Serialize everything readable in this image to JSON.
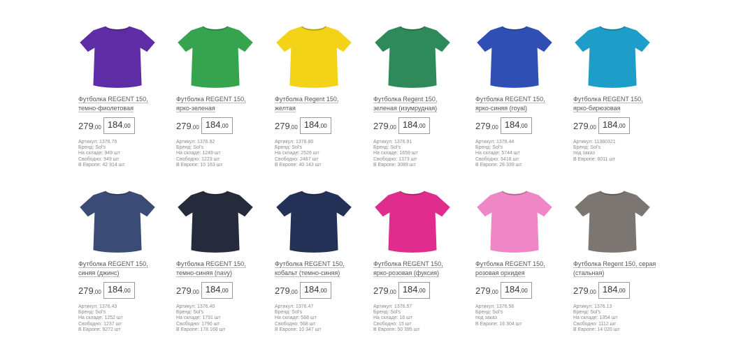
{
  "products": [
    {
      "title": "Футболка REGENT 150, темно-фиолетовая",
      "color": "#5e2ca5",
      "old_int": "279",
      "old_dec": ",00",
      "new_int": "184",
      "new_dec": ",00",
      "meta": [
        "Артикул: 1376.76",
        "Бренд: Sol's",
        "На складе: 949 шт",
        "Свободно: 949 шт",
        "В Европе: 42 914 шт"
      ]
    },
    {
      "title": "Футболка REGENT 150, ярко-зеленая",
      "color": "#36a44e",
      "old_int": "279",
      "old_dec": ",00",
      "new_int": "184",
      "new_dec": ",00",
      "meta": [
        "Артикул: 1376.92",
        "Бренд: Sol's",
        "На складе: 1249 шт",
        "Свободно: 1223 шт",
        "В Европе: 10 163 шт"
      ]
    },
    {
      "title": "Футболка Regent 150, желтая",
      "color": "#f2d317",
      "old_int": "279",
      "old_dec": ",00",
      "new_int": "184",
      "new_dec": ",00",
      "meta": [
        "Артикул: 1376.80",
        "Бренд: Sol's",
        "На складе: 2526 шт",
        "Свободно: 2487 шт",
        "В Европе: 40 143 шт"
      ]
    },
    {
      "title": "Футболка Regent 150, зеленая (изумрудная)",
      "color": "#2e8a5a",
      "old_int": "279",
      "old_dec": ",00",
      "new_int": "184",
      "new_dec": ",00",
      "meta": [
        "Артикул: 1376.91",
        "Бренд: Sol's",
        "На складе: 1659 шт",
        "Свободно: 1373 шт",
        "В Европе: 3089 шт"
      ]
    },
    {
      "title": "Футболка REGENT 150, ярко-синяя (royal)",
      "color": "#2f4fb5",
      "old_int": "279",
      "old_dec": ",00",
      "new_int": "184",
      "new_dec": ",00",
      "meta": [
        "Артикул: 1376.44",
        "Бренд: Sol's",
        "На складе: 5744 шт",
        "Свободно: 5418 шт",
        "В Европе: 26 339 шт"
      ]
    },
    {
      "title": "Футболка REGENT 150, ярко-бирюзовая",
      "color": "#1e9dc9",
      "old_int": "279",
      "old_dec": ",00",
      "new_int": "184",
      "new_dec": ",00",
      "meta": [
        "Артикул: 11380321",
        "Бренд: Sol's",
        "под заказ",
        "В Европе: 6011 шт"
      ]
    },
    {
      "title": "Футболка REGENT 150, синяя (джинс)",
      "color": "#3a4c75",
      "old_int": "279",
      "old_dec": ",00",
      "new_int": "184",
      "new_dec": ",00",
      "meta": [
        "Артикул: 1376.43",
        "Бренд: Sol's",
        "На складе: 1252 шт",
        "Свободно: 1237 шт",
        "В Европе: 9272 шт"
      ]
    },
    {
      "title": "Футболка REGENT 150, темно-синяя (navy)",
      "color": "#252b3a",
      "old_int": "279",
      "old_dec": ",00",
      "new_int": "184",
      "new_dec": ",00",
      "meta": [
        "Артикул: 1376.40",
        "Бренд: Sol's",
        "На складе: 1791 шт",
        "Свободно: 1790 шт",
        "В Европе: 178 168 шт"
      ]
    },
    {
      "title": "Футболка REGENT 150, кобальт (темно-синяя)",
      "color": "#243156",
      "old_int": "279",
      "old_dec": ",00",
      "new_int": "184",
      "new_dec": ",00",
      "meta": [
        "Артикул: 1376.47",
        "Бренд: Sol's",
        "На складе: 568 шт",
        "Свободно: 568 шт",
        "В Европе: 10 347 шт"
      ]
    },
    {
      "title": "Футболка REGENT 150, ярко-розовая (фуксия)",
      "color": "#e02c8d",
      "old_int": "279",
      "old_dec": ",00",
      "new_int": "184",
      "new_dec": ",00",
      "meta": [
        "Артикул: 1376.57",
        "Бренд: Sol's",
        "На складе: 16 шт",
        "Свободно: 15 шт",
        "В Европе: 50 395 шт"
      ]
    },
    {
      "title": "Футболка REGENT 150, розовая орхидея",
      "color": "#ef86c6",
      "old_int": "279",
      "old_dec": ",00",
      "new_int": "184",
      "new_dec": ",00",
      "meta": [
        "Артикул: 1376.56",
        "Бренд: Sol's",
        "под заказ",
        "В Европе: 16 304 шт"
      ]
    },
    {
      "title": "Футболка Regent 150, серая (стальная)",
      "color": "#7b7672",
      "old_int": "279",
      "old_dec": ",00",
      "new_int": "184",
      "new_dec": ",00",
      "meta": [
        "Артикул: 1376.13",
        "Бренд: Sol's",
        "На складе: 1354 шт",
        "Свободно: 1112 шт",
        "В Европе: 14 020 шт"
      ]
    }
  ]
}
